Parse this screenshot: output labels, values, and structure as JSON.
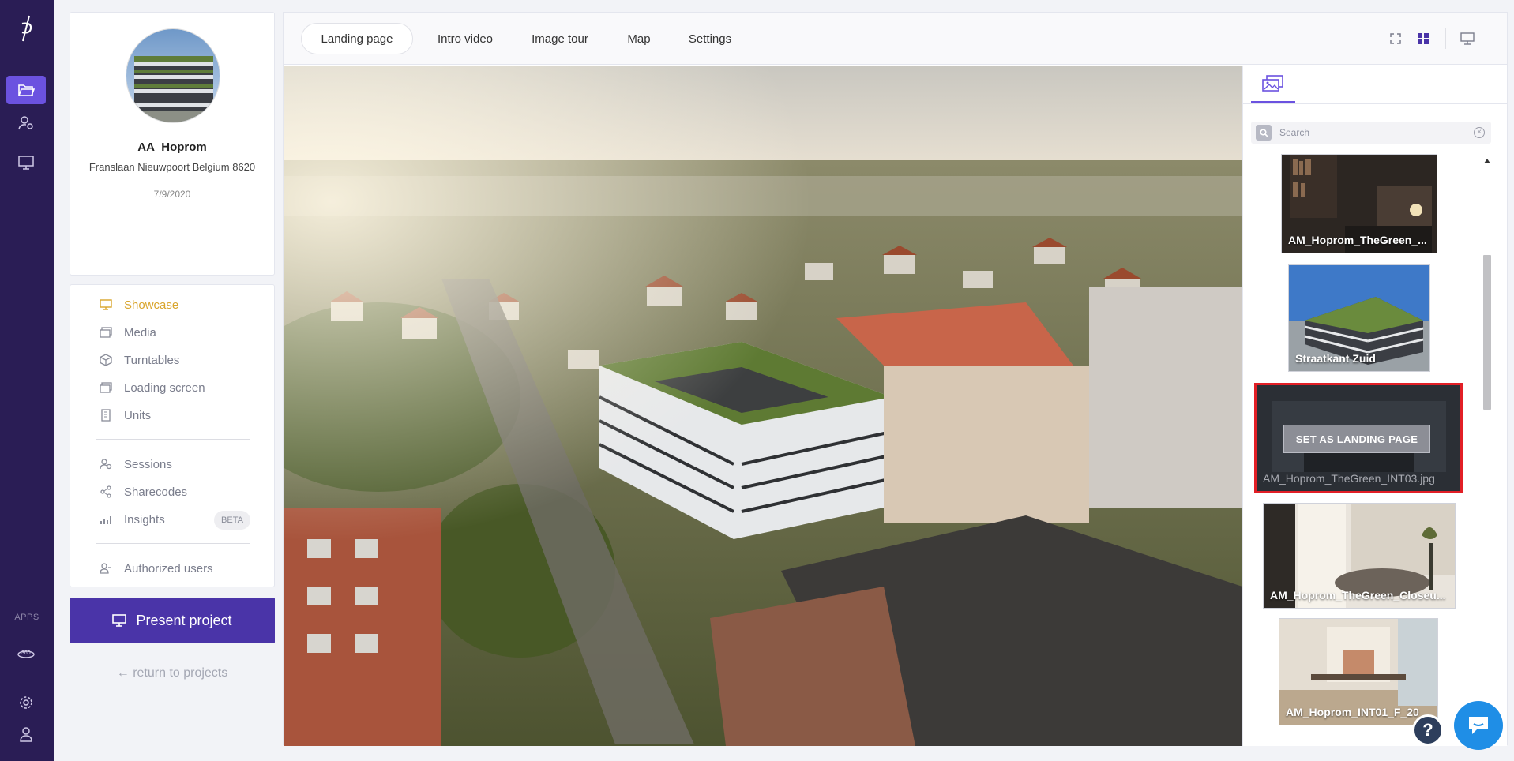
{
  "rail": {
    "apps_label": "APPS"
  },
  "project": {
    "name": "AA_Hoprom",
    "address": "Franslaan Nieuwpoort Belgium 8620",
    "date": "7/9/2020"
  },
  "menu": {
    "items": [
      {
        "label": "Showcase",
        "icon": "monitor-icon"
      },
      {
        "label": "Media",
        "icon": "media-icon"
      },
      {
        "label": "Turntables",
        "icon": "cube-icon"
      },
      {
        "label": "Loading screen",
        "icon": "loading-screen-icon"
      },
      {
        "label": "Units",
        "icon": "building-icon"
      },
      {
        "label": "Sessions",
        "icon": "sessions-icon"
      },
      {
        "label": "Sharecodes",
        "icon": "share-icon"
      },
      {
        "label": "Insights",
        "icon": "insights-icon"
      },
      {
        "label": "Authorized users",
        "icon": "users-icon"
      }
    ],
    "beta_badge": "BETA"
  },
  "present_button": "Present project",
  "return_link": "← return to projects",
  "tabs": [
    "Landing page",
    "Intro video",
    "Image tour",
    "Map",
    "Settings"
  ],
  "gallery": {
    "search_placeholder": "Search",
    "set_landing_label": "SET AS LANDING PAGE",
    "items": [
      {
        "caption": "AM_Hoprom_TheGreen_..."
      },
      {
        "caption": "Straatkant Zuid"
      },
      {
        "caption": "AM_Hoprom_TheGreen_INT03.jpg"
      },
      {
        "caption": "AM_Hoprom_TheGreen_Closeu..."
      },
      {
        "caption": "AM_Hoprom_INT01_F_20"
      }
    ]
  },
  "colors": {
    "rail": "#2a1d55",
    "accent": "#6b52e0",
    "present_button": "#4a34a8",
    "active_menu": "#d9a52c",
    "selected_border": "#e21f26",
    "chat": "#1f8ee6"
  }
}
